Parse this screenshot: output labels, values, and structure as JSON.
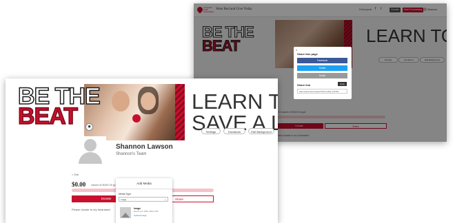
{
  "back": {
    "org_logo": "American Heart Association",
    "page_title": "Wear Red and Give Today",
    "nav_link": "Participants",
    "social_icons": [
      "f",
      "t"
    ],
    "donate_label": "Donate",
    "start_label": "Start Fundraising",
    "user_label": "Shannon",
    "learn_text": "LEARN TO SAVE A LI",
    "pills": [
      "Settings",
      "Donations",
      "Edit Background"
    ],
    "amount_text": "$0.00 raised of $200.00 goal",
    "donate_big": "Donate",
    "share_big": "Share",
    "please_text": "Please donate to my fundraiser!",
    "modal": {
      "close": "×",
      "share_heading": "Share this page",
      "facebook": "Facebook",
      "twitter": "Twitter",
      "email": "Email",
      "link_heading": "Share link",
      "copy": "Copy",
      "link_value": "https://www2.heart.org/site/TR?px=123&fr_id=6789"
    }
  },
  "front": {
    "be_the": "BE THE",
    "beat": "BEAT",
    "learn_line1": "LEARN TO",
    "learn_line2": "SAVE A LI",
    "pills": [
      "Settings",
      "Donations",
      "Edit Background"
    ],
    "name": "Shannon Lawson",
    "team": "Shannon's Team",
    "back_link": "< Edit",
    "amount": "$0.00",
    "raised_text": "raised of $200.00 goal",
    "donate_big": "Donate",
    "share_big": "Share",
    "please_text": "Please donate to my fundraiser!",
    "media": {
      "heading": "Add Media",
      "type_label": "Media Type",
      "type_value": "Image",
      "chevron": "⌄",
      "item_type": "Image",
      "item_requirements": "Max file size: 5MB | JPEG, PNG",
      "upload_label": "Upload Image"
    }
  }
}
